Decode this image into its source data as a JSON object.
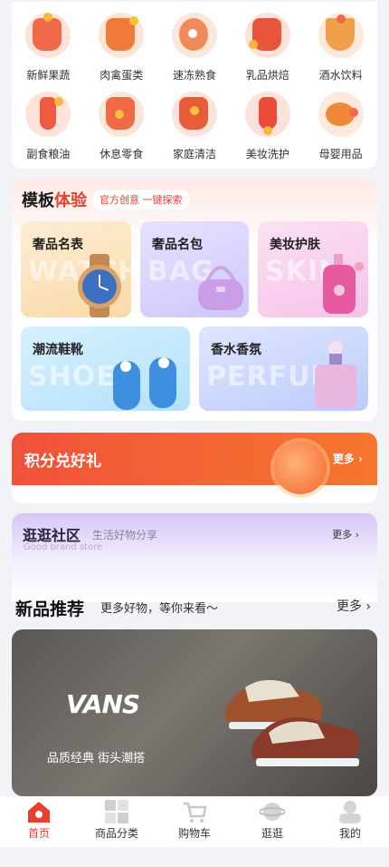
{
  "categories": [
    {
      "label": "新鲜果蔬",
      "icon": "lantern-icon",
      "color": "#f06a4a"
    },
    {
      "label": "肉禽蛋类",
      "icon": "gift-icon",
      "color": "#f07a3a"
    },
    {
      "label": "速冻熟食",
      "icon": "tiger-icon",
      "color": "#f08a5a"
    },
    {
      "label": "乳品烘焙",
      "icon": "chair-icon",
      "color": "#e8553a"
    },
    {
      "label": "酒水饮料",
      "icon": "bowl-icon",
      "color": "#f0a04a"
    },
    {
      "label": "副食粮油",
      "icon": "firecracker-icon",
      "color": "#ef5a40"
    },
    {
      "label": "休息零食",
      "icon": "basket-icon",
      "color": "#f06b45"
    },
    {
      "label": "家庭清洁",
      "icon": "hongbao-icon",
      "color": "#e85c3a"
    },
    {
      "label": "美妆洗护",
      "icon": "knot-icon",
      "color": "#ea4b3a"
    },
    {
      "label": "母婴用品",
      "icon": "fish-icon",
      "color": "#f0883a"
    }
  ],
  "template": {
    "title_part1": "模板",
    "title_part2": "体验",
    "subtitle": "官方创意 一键探索",
    "tiles": [
      {
        "label": "奢品名表",
        "bg_text": "WATCH"
      },
      {
        "label": "奢品名包",
        "bg_text": "BAG"
      },
      {
        "label": "美妆护肤",
        "bg_text": "SKIN"
      },
      {
        "label": "潮流鞋靴",
        "bg_text": "SHOES"
      },
      {
        "label": "香水香氛",
        "bg_text": "PERFUME"
      }
    ]
  },
  "points": {
    "title": "积分兑好礼",
    "more": "更多 ›"
  },
  "community": {
    "title": "逛逛社区",
    "subtitle": "生活好物分享",
    "english": "Good brand store",
    "more": "更多 ›"
  },
  "new_products": {
    "title": "新品推荐",
    "subtitle": "更多好物，等你来看～",
    "more": "更多 ›"
  },
  "banner": {
    "brand": "VANS",
    "slogan": "品质经典 街头潮搭"
  },
  "tabbar": [
    {
      "label": "首页",
      "icon": "home-icon",
      "active": true
    },
    {
      "label": "商品分类",
      "icon": "category-icon",
      "active": false
    },
    {
      "label": "购物车",
      "icon": "cart-icon",
      "active": false
    },
    {
      "label": "逛逛",
      "icon": "planet-icon",
      "active": false
    },
    {
      "label": "我的",
      "icon": "user-icon",
      "active": false
    }
  ],
  "colors": {
    "accent": "#e8402c",
    "points_bar": "#f0523a"
  }
}
